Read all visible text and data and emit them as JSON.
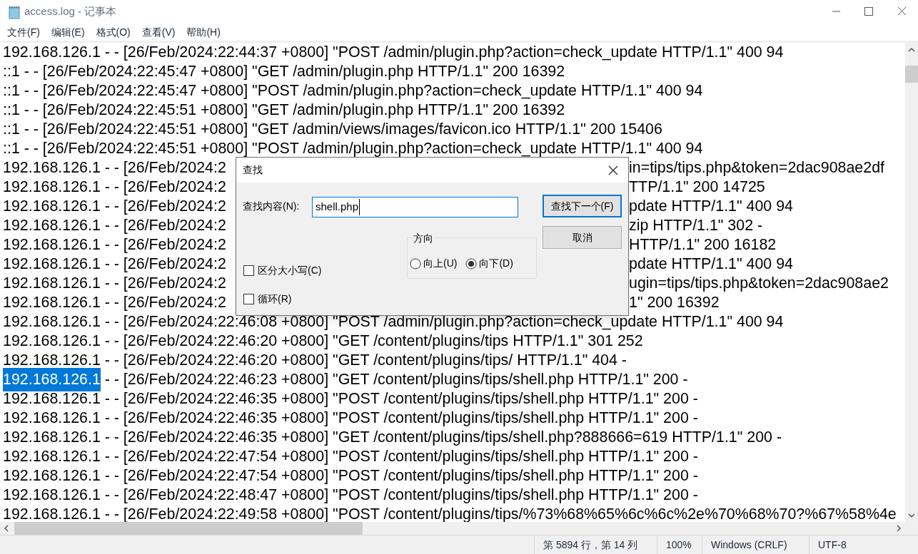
{
  "window": {
    "title": "access.log - 记事本"
  },
  "menu": [
    "文件(F)",
    "编辑(E)",
    "格式(O)",
    "查看(V)",
    "帮助(H)"
  ],
  "lines": [
    {
      "kind": "full",
      "text": "192.168.126.1 - - [26/Feb/2024:22:44:37 +0800] \"POST /admin/plugin.php?action=check_update HTTP/1.1\" 400 94"
    },
    {
      "kind": "full",
      "text": "::1 - - [26/Feb/2024:22:45:47 +0800] \"GET /admin/plugin.php HTTP/1.1\" 200 16392"
    },
    {
      "kind": "full",
      "text": "::1 - - [26/Feb/2024:22:45:47 +0800] \"POST /admin/plugin.php?action=check_update HTTP/1.1\" 400 94"
    },
    {
      "kind": "full",
      "text": "::1 - - [26/Feb/2024:22:45:51 +0800] \"GET /admin/plugin.php HTTP/1.1\" 200 16392"
    },
    {
      "kind": "full",
      "text": "::1 - - [26/Feb/2024:22:45:51 +0800] \"GET /admin/views/images/favicon.ico HTTP/1.1\" 200 15406"
    },
    {
      "kind": "full",
      "text": "::1 - - [26/Feb/2024:22:45:51 +0800] \"POST /admin/plugin.php?action=check_update HTTP/1.1\" 400 94"
    },
    {
      "kind": "covered",
      "left": "192.168.126.1 - - [26/Feb/2024:2",
      "right": "in=tips/tips.php&token=2dac908ae2df"
    },
    {
      "kind": "covered",
      "left": "192.168.126.1 - - [26/Feb/2024:2",
      "right": "TTP/1.1\" 200 14725"
    },
    {
      "kind": "covered",
      "left": "192.168.126.1 - - [26/Feb/2024:2",
      "right": "pdate HTTP/1.1\" 400 94"
    },
    {
      "kind": "covered",
      "left": "192.168.126.1 - - [26/Feb/2024:2",
      "right": "zip HTTP/1.1\" 302 -"
    },
    {
      "kind": "covered",
      "left": "192.168.126.1 - - [26/Feb/2024:2",
      "right": "HTTP/1.1\" 200 16182"
    },
    {
      "kind": "covered",
      "left": "192.168.126.1 - - [26/Feb/2024:2",
      "right": "pdate HTTP/1.1\" 400 94"
    },
    {
      "kind": "covered",
      "left": "192.168.126.1 - - [26/Feb/2024:2",
      "right": "ugin=tips/tips.php&token=2dac908ae2"
    },
    {
      "kind": "covered",
      "left": "192.168.126.1 - - [26/Feb/2024:2",
      "right": "1\" 200 16392"
    },
    {
      "kind": "full",
      "text": "192.168.126.1 - - [26/Feb/2024:22:46:08 +0800] \"POST /admin/plugin.php?action=check_update HTTP/1.1\" 400 94"
    },
    {
      "kind": "full",
      "text": "192.168.126.1 - - [26/Feb/2024:22:46:20 +0800] \"GET /content/plugins/tips HTTP/1.1\" 301 252"
    },
    {
      "kind": "full",
      "text": "192.168.126.1 - - [26/Feb/2024:22:46:20 +0800] \"GET /content/plugins/tips/ HTTP/1.1\" 404 -"
    },
    {
      "kind": "selected",
      "selection": "192.168.126.1",
      "text": " - - [26/Feb/2024:22:46:23 +0800] \"GET /content/plugins/tips/shell.php HTTP/1.1\" 200 -"
    },
    {
      "kind": "full",
      "text": "192.168.126.1 - - [26/Feb/2024:22:46:35 +0800] \"POST /content/plugins/tips/shell.php HTTP/1.1\" 200 -"
    },
    {
      "kind": "full",
      "text": "192.168.126.1 - - [26/Feb/2024:22:46:35 +0800] \"POST /content/plugins/tips/shell.php HTTP/1.1\" 200 -"
    },
    {
      "kind": "full",
      "text": "192.168.126.1 - - [26/Feb/2024:22:46:35 +0800] \"GET /content/plugins/tips/shell.php?888666=619 HTTP/1.1\" 200 -"
    },
    {
      "kind": "full",
      "text": "192.168.126.1 - - [26/Feb/2024:22:47:54 +0800] \"POST /content/plugins/tips/shell.php HTTP/1.1\" 200 -"
    },
    {
      "kind": "full",
      "text": "192.168.126.1 - - [26/Feb/2024:22:47:54 +0800] \"POST /content/plugins/tips/shell.php HTTP/1.1\" 200 -"
    },
    {
      "kind": "full",
      "text": "192.168.126.1 - - [26/Feb/2024:22:48:47 +0800] \"POST /content/plugins/tips/shell.php HTTP/1.1\" 200 -"
    },
    {
      "kind": "full",
      "text": "192.168.126.1 - - [26/Feb/2024:22:49:58 +0800] \"POST /content/plugins/tips/%73%68%65%6c%6c%2e%70%68%70?%67%58%4e"
    }
  ],
  "find_dialog": {
    "title": "查找",
    "label": "查找内容(N):",
    "value": "shell.php",
    "find_next": "查找下一个(F)",
    "cancel": "取消",
    "match_case": {
      "label": "区分大小写(C)",
      "checked": false
    },
    "wrap": {
      "label": "循环(R)",
      "checked": false
    },
    "direction": {
      "title": "方向",
      "options": [
        {
          "label": "向上(U)",
          "selected": false
        },
        {
          "label": "向下(D)",
          "selected": true
        }
      ]
    }
  },
  "status_bar": [
    "第 5894 行，第 14 列",
    "100%",
    "Windows (CRLF)",
    "UTF-8"
  ]
}
